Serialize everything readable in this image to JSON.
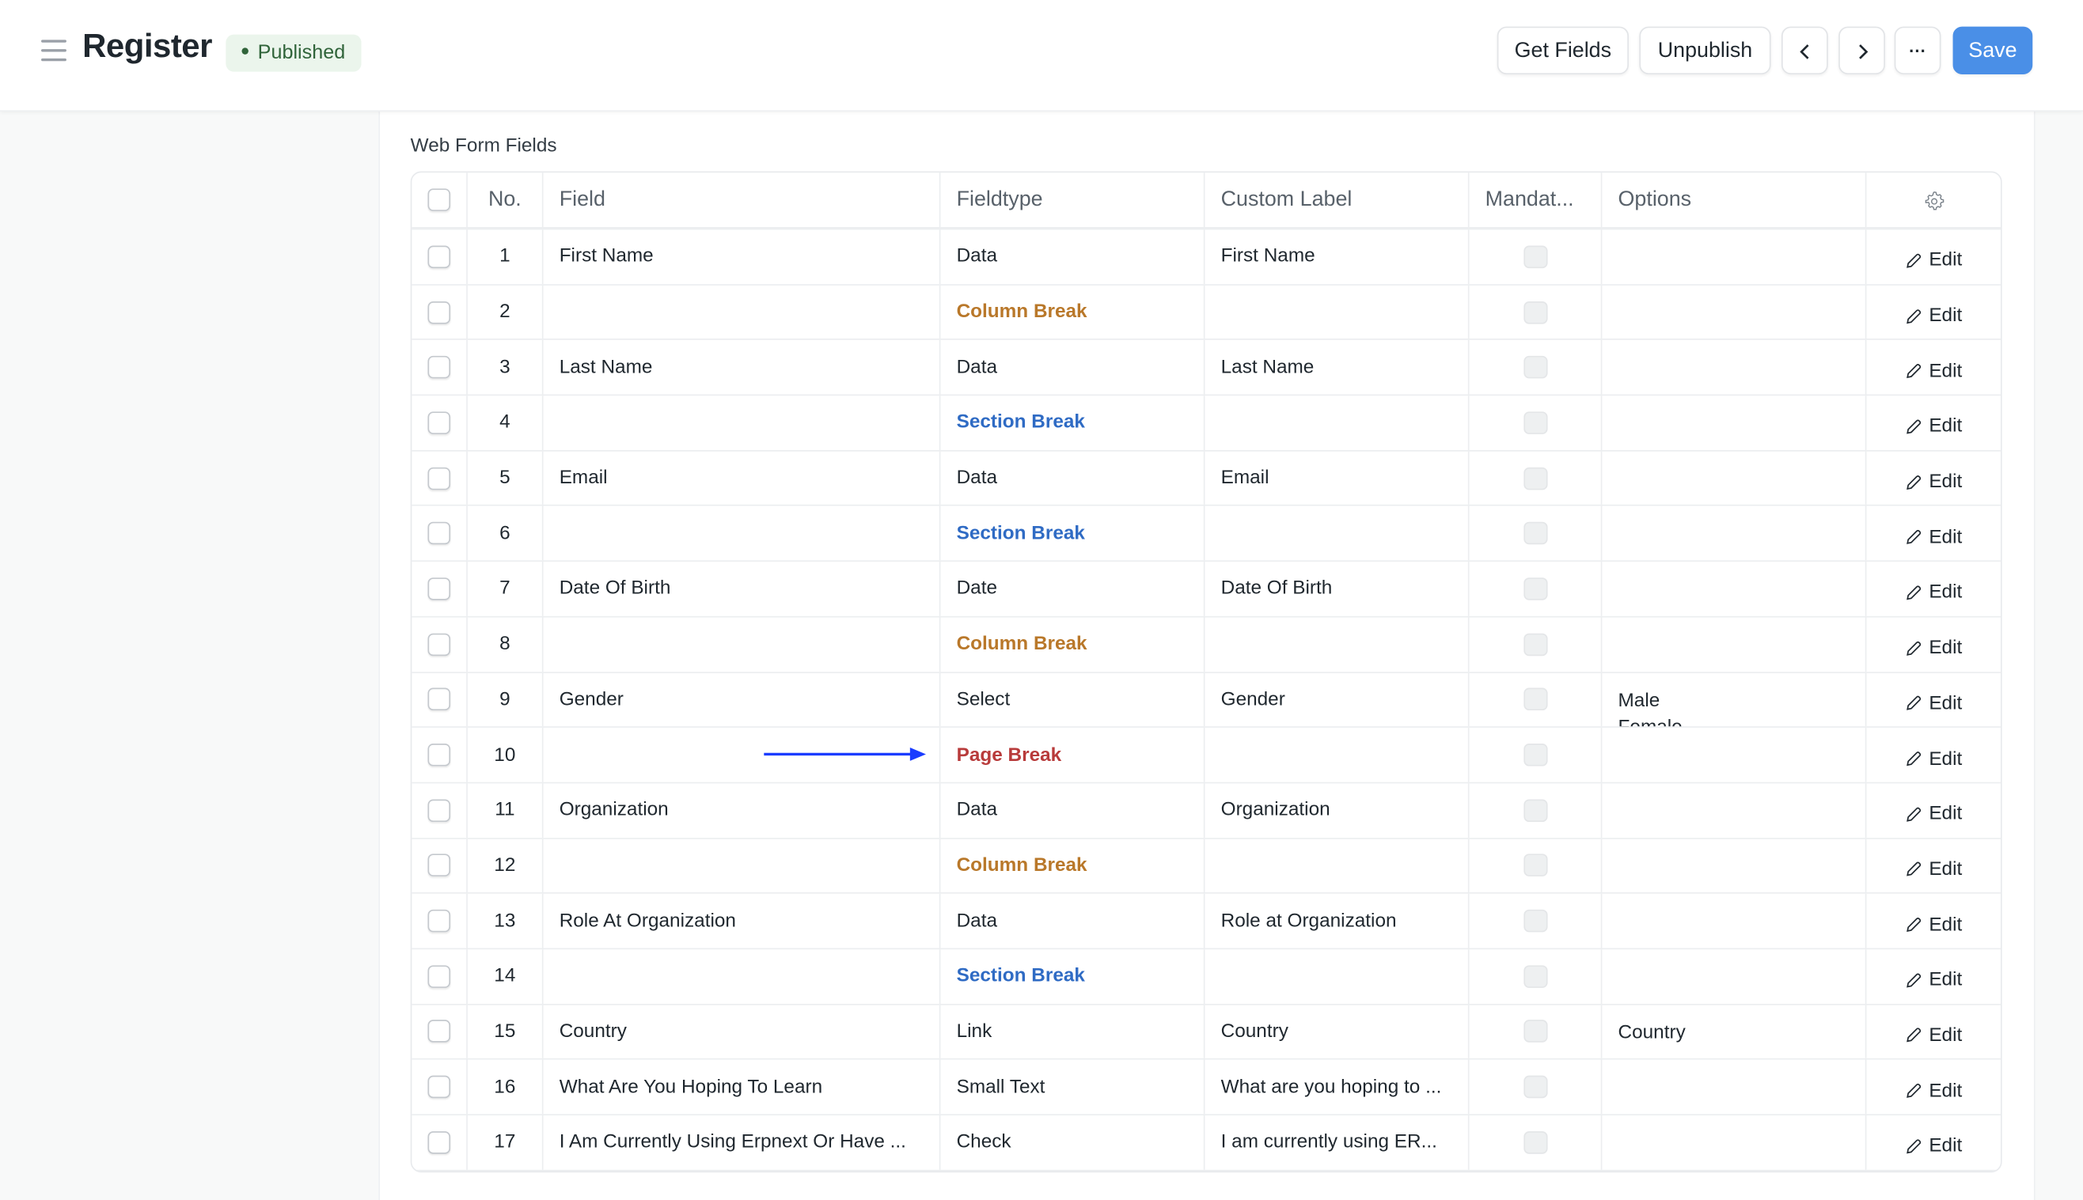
{
  "header": {
    "title": "Register",
    "status": "Published",
    "buttons": {
      "get_fields": "Get Fields",
      "unpublish": "Unpublish",
      "prev": "‹",
      "next": "›",
      "more": "···",
      "save": "Save"
    }
  },
  "colors": {
    "primary": "#4a8fe7",
    "published_bg": "#ebf5ec",
    "published_text": "#30643a",
    "Column Break": "#b9782a",
    "Section Break": "#2f6bc4",
    "Page Break": "#b83b3b",
    "arrow": "#1a3cff"
  },
  "section_label": "Web Form Fields",
  "table": {
    "columns": {
      "no": "No.",
      "field": "Field",
      "fieldtype": "Fieldtype",
      "custom_label": "Custom Label",
      "mandatory": "Mandat...",
      "options": "Options"
    },
    "edit_label": "Edit",
    "rows": [
      {
        "no": "1",
        "field": "First Name",
        "fieldtype": "Data",
        "label": "First Name",
        "options": []
      },
      {
        "no": "2",
        "field": "",
        "fieldtype": "Column Break",
        "label": "",
        "options": []
      },
      {
        "no": "3",
        "field": "Last Name",
        "fieldtype": "Data",
        "label": "Last Name",
        "options": []
      },
      {
        "no": "4",
        "field": "",
        "fieldtype": "Section Break",
        "label": "",
        "options": []
      },
      {
        "no": "5",
        "field": "Email",
        "fieldtype": "Data",
        "label": "Email",
        "options": []
      },
      {
        "no": "6",
        "field": "",
        "fieldtype": "Section Break",
        "label": "",
        "options": []
      },
      {
        "no": "7",
        "field": "Date Of Birth",
        "fieldtype": "Date",
        "label": "Date Of Birth",
        "options": []
      },
      {
        "no": "8",
        "field": "",
        "fieldtype": "Column Break",
        "label": "",
        "options": []
      },
      {
        "no": "9",
        "field": "Gender",
        "fieldtype": "Select",
        "label": "Gender",
        "options": [
          "Male",
          "Female"
        ]
      },
      {
        "no": "10",
        "field": "",
        "fieldtype": "Page Break",
        "label": "",
        "options": []
      },
      {
        "no": "11",
        "field": "Organization",
        "fieldtype": "Data",
        "label": "Organization",
        "options": []
      },
      {
        "no": "12",
        "field": "",
        "fieldtype": "Column Break",
        "label": "",
        "options": []
      },
      {
        "no": "13",
        "field": "Role At Organization",
        "fieldtype": "Data",
        "label": "Role at Organization",
        "options": []
      },
      {
        "no": "14",
        "field": "",
        "fieldtype": "Section Break",
        "label": "",
        "options": []
      },
      {
        "no": "15",
        "field": "Country",
        "fieldtype": "Link",
        "label": "Country",
        "options": [
          "Country"
        ]
      },
      {
        "no": "16",
        "field": "What Are You Hoping To Learn",
        "fieldtype": "Small Text",
        "label": "What are you hoping to ...",
        "options": []
      },
      {
        "no": "17",
        "field": "I Am Currently Using Erpnext Or Have ...",
        "fieldtype": "Check",
        "label": "I am currently using ER...",
        "options": []
      }
    ]
  }
}
